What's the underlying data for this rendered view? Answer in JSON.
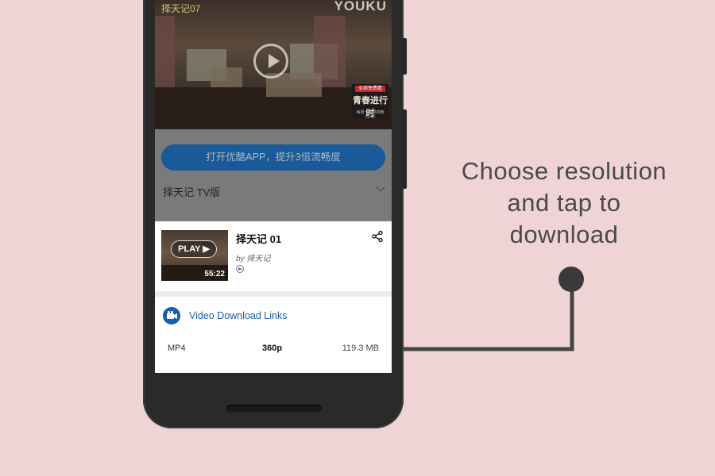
{
  "caption": {
    "lines": [
      "Choose resolution",
      "and tap to",
      "download"
    ]
  },
  "video_player": {
    "channel_logo": "择天记07",
    "watermark": "YOUKU",
    "promo": {
      "tag": "全部免费看",
      "title": "青春进行时",
      "subtitle": "每周一至周四晚22:00"
    }
  },
  "page": {
    "open_app_button": "打开优酷APP，提升3倍流畅度",
    "show_title": "择天记 TV版"
  },
  "sheet": {
    "thumbnail": {
      "play_label": "PLAY ▶",
      "duration": "55:22"
    },
    "episode_title": "择天记 01",
    "byline": "by 择天记",
    "download_section_label": "Video Download Links",
    "download_links": [
      {
        "format": "MP4",
        "resolution": "360p",
        "size": "119.3 MB"
      }
    ]
  },
  "colors": {
    "background": "#f0d3d5",
    "accent_blue": "#1c5ea8",
    "caption_text": "#4a4a4a"
  }
}
